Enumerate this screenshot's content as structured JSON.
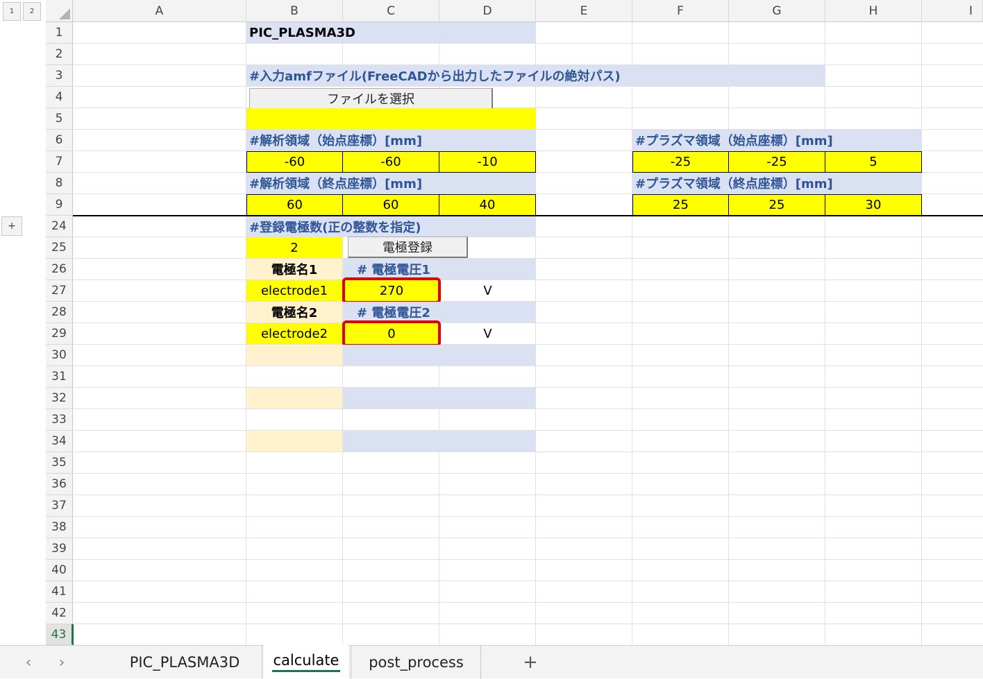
{
  "outline": {
    "level1": "1",
    "level2": "2",
    "expand": "+"
  },
  "columns": [
    "A",
    "B",
    "C",
    "D",
    "E",
    "F",
    "G",
    "H",
    "I"
  ],
  "rows": [
    "1",
    "2",
    "3",
    "4",
    "5",
    "6",
    "7",
    "8",
    "9",
    "24",
    "25",
    "26",
    "27",
    "28",
    "29",
    "30",
    "31",
    "32",
    "33",
    "34",
    "35",
    "36",
    "37",
    "38",
    "39",
    "40",
    "41",
    "42",
    "43"
  ],
  "title": "PIC_PLASMA3D",
  "input_amf_label": "#入力amfファイル(FreeCADから出力したファイルの絶対パス)",
  "select_file_button": "ファイルを選択",
  "analysis_start_label": "#解析領域（始点座標）[mm]",
  "analysis_start": [
    "-60",
    "-60",
    "-10"
  ],
  "analysis_end_label": "#解析領域（終点座標）[mm]",
  "analysis_end": [
    "60",
    "60",
    "40"
  ],
  "plasma_start_label": "#プラズマ領域（始点座標）[mm]",
  "plasma_start": [
    "-25",
    "-25",
    "5"
  ],
  "plasma_end_label": "#プラズマ領域（終点座標）[mm]",
  "plasma_end": [
    "25",
    "25",
    "30"
  ],
  "electrode_count_label": "#登録電極数(正の整数を指定)",
  "electrode_count": "2",
  "register_button": "電極登録",
  "electrodes": [
    {
      "name_label": "電極名1",
      "voltage_label": "# 電極電圧1",
      "name": "electrode1",
      "voltage": "270",
      "unit": "V"
    },
    {
      "name_label": "電極名2",
      "voltage_label": "# 電極電圧2",
      "name": "electrode2",
      "voltage": "0",
      "unit": "V"
    }
  ],
  "sheet_tabs": [
    "PIC_PLASMA3D",
    "calculate",
    "post_process"
  ],
  "active_tab": "calculate",
  "add_sheet": "+",
  "nav_prev": "‹",
  "nav_next": "›",
  "colors": {
    "yellow": "#ffff00",
    "light_blue": "#d9e1f2",
    "cream": "#fff2cc",
    "header_blue": "#2f5597",
    "highlight_red": "#e00000",
    "excel_green": "#217346"
  }
}
